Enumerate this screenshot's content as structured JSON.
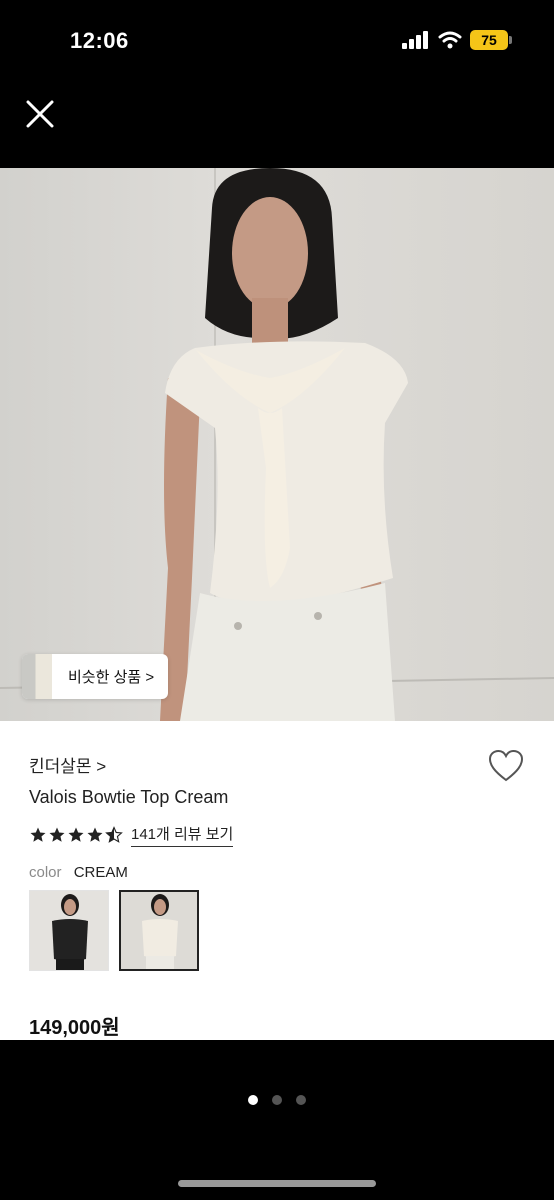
{
  "status": {
    "time": "12:06",
    "battery": "75"
  },
  "similar": {
    "label": "비슷한 상품 >"
  },
  "product": {
    "brand": "킨더살몬 >",
    "name": "Valois Bowtie Top Cream",
    "rating": 4.5,
    "reviews_label": "141개 리뷰 보기",
    "color_label": "color",
    "color_value": "CREAM",
    "swatches": [
      {
        "name": "black",
        "selected": false
      },
      {
        "name": "cream",
        "selected": true
      }
    ],
    "price": "149,000원"
  },
  "pager": {
    "count": 3,
    "active": 1
  },
  "colors": {
    "background": "#000000",
    "card": "#ffffff",
    "text": "#111111",
    "muted": "#8a8a8a",
    "battery": "#f5c518"
  },
  "icons": [
    "close-icon",
    "heart-icon",
    "star-icon",
    "signal-icon",
    "wifi-icon",
    "battery-icon"
  ]
}
